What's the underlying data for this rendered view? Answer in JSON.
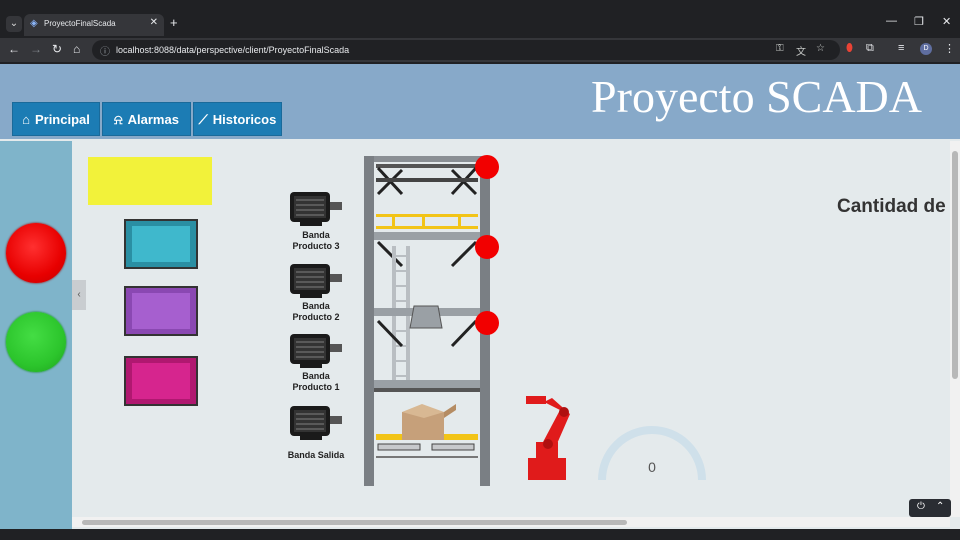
{
  "browser": {
    "tab_title": "ProyectoFinalScada",
    "url": "localhost:8088/data/perspective/client/ProyectoFinalScada",
    "profile_initial": "D",
    "tab_icon": "perspective-icon"
  },
  "header": {
    "title": "Proyecto SCADA",
    "nav": [
      {
        "icon": "home-icon",
        "label": "Principal"
      },
      {
        "icon": "bell-icon",
        "label": "Alarmas"
      },
      {
        "icon": "trend-icon",
        "label": "Historicos"
      }
    ]
  },
  "motors": [
    {
      "label_line1": "Banda",
      "label_line2": "Producto 3"
    },
    {
      "label_line1": "Banda",
      "label_line2": "Producto 2"
    },
    {
      "label_line1": "Banda",
      "label_line2": "Producto 1"
    },
    {
      "label_line1": "Banda Salida",
      "label_line2": ""
    }
  ],
  "main": {
    "cantidad_label": "Cantidad de",
    "gauge_value": "0",
    "gauge_fraction": 0
  },
  "colors": {
    "header": "#87a9c9",
    "nav_button": "#1c7cb4",
    "indicator_yellow": "#f2f23a",
    "box_cyan": "#3fb8cc",
    "box_purple": "#a65fcf",
    "box_magenta": "#d6258e",
    "stop_red": "#e80000",
    "start_green": "#2cc52c",
    "robot_red": "#e01b1b"
  }
}
